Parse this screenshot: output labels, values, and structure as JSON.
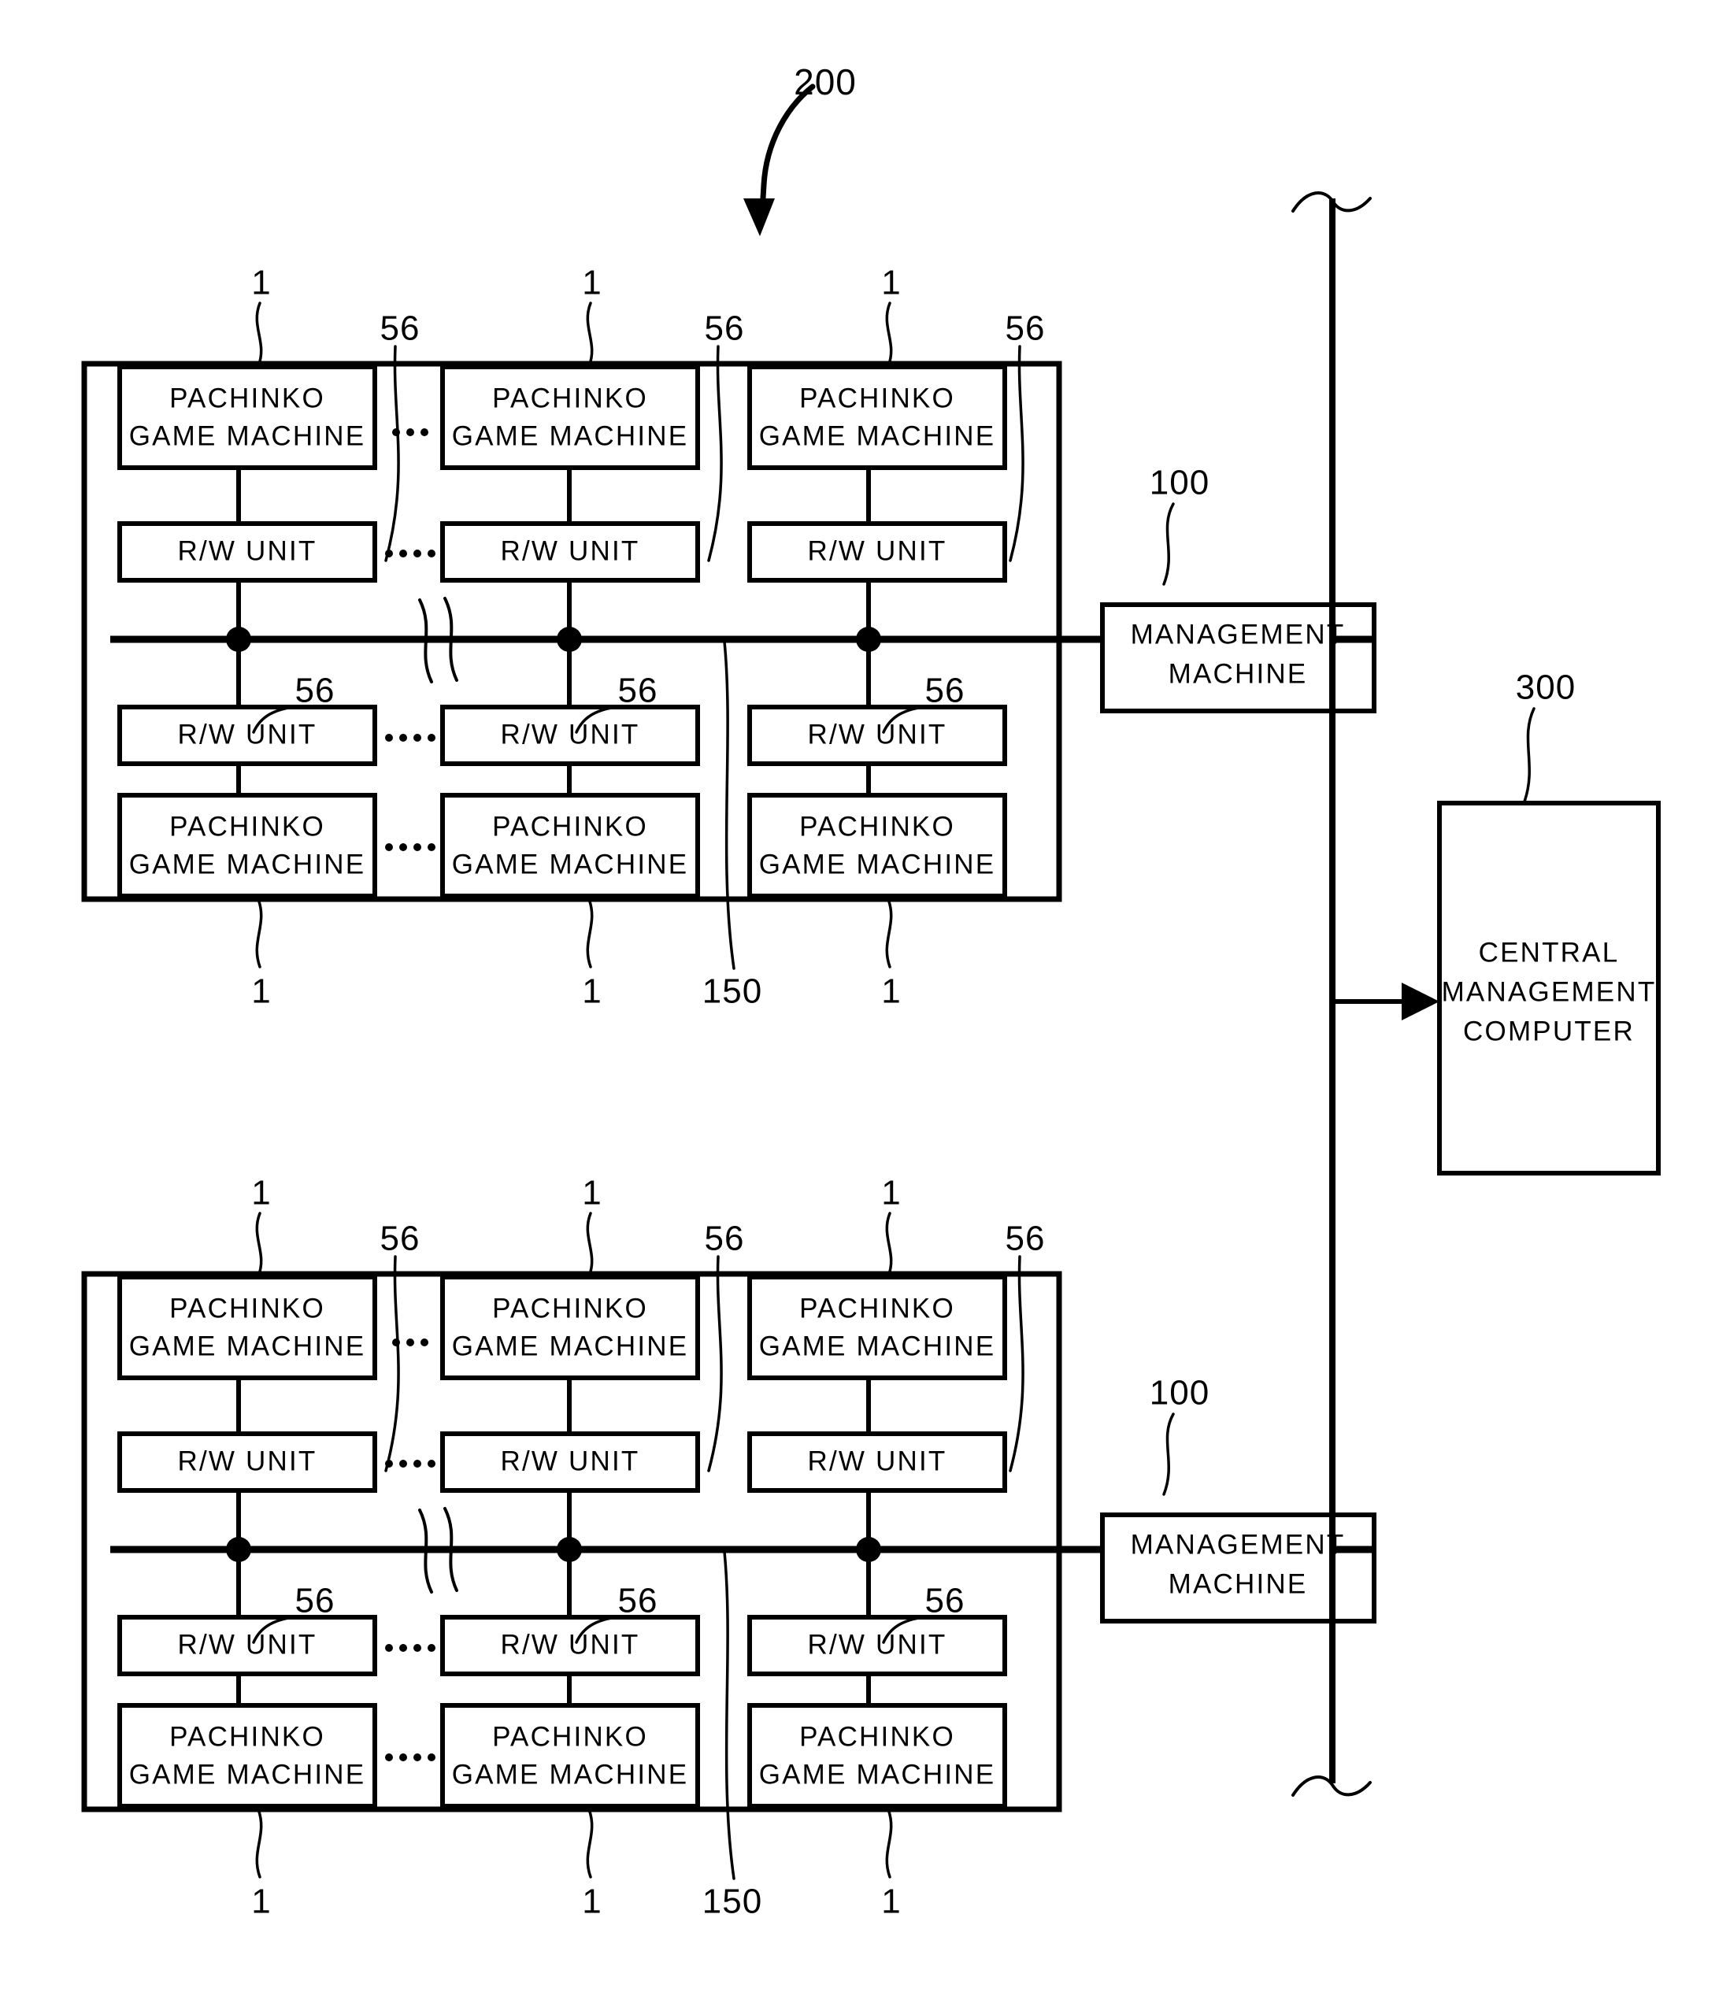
{
  "figure": {
    "title": "Pachinko game machine management system block diagram",
    "system_ref": "200"
  },
  "labels": {
    "pachinko_game_machine": "PACHINKO\nGAME MACHINE",
    "pachinko_line1": "PACHINKO",
    "pachinko_line2": "GAME MACHINE",
    "rw_unit": "R/W UNIT",
    "management_machine_line1": "MANAGEMENT",
    "management_machine_line2": "MACHINE",
    "central_computer_line1": "CENTRAL",
    "central_computer_line2": "MANAGEMENT",
    "central_computer_line3": "COMPUTER"
  },
  "reference_numerals": {
    "system": "200",
    "pachinko_game_machine": "1",
    "rw_unit": "56",
    "management_machine": "100",
    "central_management_computer": "300",
    "bus_line": "150"
  },
  "hall_groups": [
    {
      "id": "upper-hall",
      "management_machine_ref": "100",
      "bus_ref": "150",
      "top_row": [
        {
          "machine_label": "PACHINKO GAME MACHINE",
          "machine_ref": "1",
          "rw_label": "R/W UNIT",
          "rw_ref": "56"
        },
        {
          "machine_label": "PACHINKO GAME MACHINE",
          "machine_ref": "1",
          "rw_label": "R/W UNIT",
          "rw_ref": "56"
        },
        {
          "machine_label": "PACHINKO GAME MACHINE",
          "machine_ref": "1",
          "rw_label": "R/W UNIT",
          "rw_ref": "56"
        }
      ],
      "bottom_row": [
        {
          "rw_label": "R/W UNIT",
          "rw_ref": "56",
          "machine_label": "PACHINKO GAME MACHINE",
          "machine_ref": "1"
        },
        {
          "rw_label": "R/W UNIT",
          "rw_ref": "56",
          "machine_label": "PACHINKO GAME MACHINE",
          "machine_ref": "1"
        },
        {
          "rw_label": "R/W UNIT",
          "rw_ref": "56",
          "machine_label": "PACHINKO GAME MACHINE",
          "machine_ref": "1"
        }
      ]
    },
    {
      "id": "lower-hall",
      "management_machine_ref": "100",
      "bus_ref": "150",
      "top_row": [
        {
          "machine_label": "PACHINKO GAME MACHINE",
          "machine_ref": "1",
          "rw_label": "R/W UNIT",
          "rw_ref": "56"
        },
        {
          "machine_label": "PACHINKO GAME MACHINE",
          "machine_ref": "1",
          "rw_label": "R/W UNIT",
          "rw_ref": "56"
        },
        {
          "machine_label": "PACHINKO GAME MACHINE",
          "machine_ref": "1",
          "rw_label": "R/W UNIT",
          "rw_ref": "56"
        }
      ],
      "bottom_row": [
        {
          "rw_label": "R/W UNIT",
          "rw_ref": "56",
          "machine_label": "PACHINKO GAME MACHINE",
          "machine_ref": "1"
        },
        {
          "rw_label": "R/W UNIT",
          "rw_ref": "56",
          "machine_label": "PACHINKO GAME MACHINE",
          "machine_ref": "1"
        },
        {
          "rw_label": "R/W UNIT",
          "rw_ref": "56",
          "machine_label": "PACHINKO GAME MACHINE",
          "machine_ref": "1"
        }
      ]
    }
  ],
  "central_computer": {
    "label": "CENTRAL MANAGEMENT COMPUTER",
    "ref": "300"
  },
  "colors": {
    "ink": "#000000",
    "paper": "#ffffff"
  }
}
